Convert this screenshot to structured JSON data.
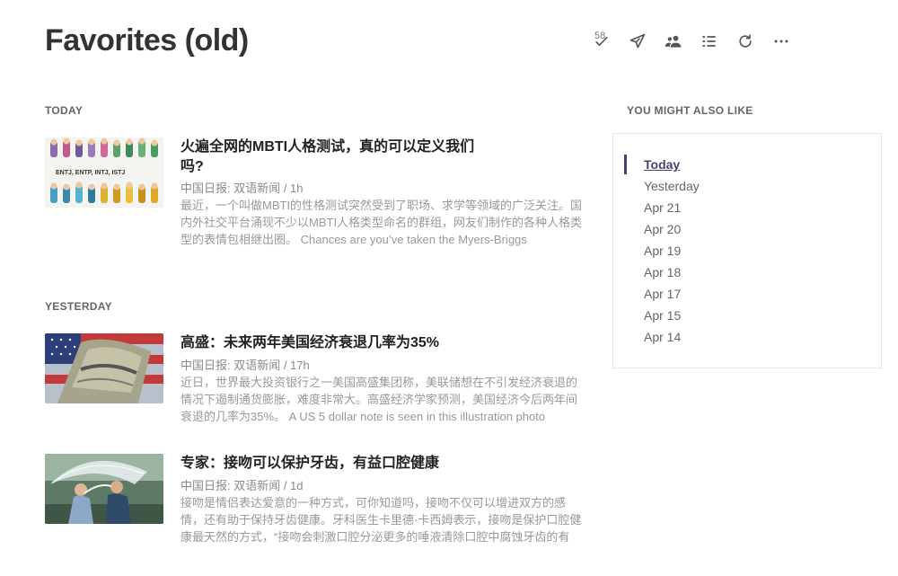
{
  "header": {
    "title": "Favorites (old)",
    "toolbar": {
      "unread_count": "58",
      "mark_read_icon": "check-icon",
      "share_icon": "send-icon",
      "people_icon": "people-icon",
      "list_icon": "list-icon",
      "refresh_icon": "refresh-icon",
      "more_icon": "more-icon"
    }
  },
  "sections": [
    {
      "label": "TODAY",
      "articles": [
        {
          "title": "火遍全网的MBTI人格测试，真的可以定义我们吗?",
          "source": "中国日报: 双语新闻 / 1h",
          "summary": "最近，一个叫做MBTI的性格测试突然受到了职场、求学等领域的广泛关注。国内外社交平台涌现不少以MBTI人格类型命名的群组，网友们制作的各种人格类型的表情包相继出圈。 Chances are you’ve taken the Myers-Briggs",
          "thumb_text": "ENTJ, ENTP, INTJ, ISTJ"
        }
      ]
    },
    {
      "label": "YESTERDAY",
      "articles": [
        {
          "title": "高盛：未来两年美国经济衰退几率为35%",
          "source": "中国日报: 双语新闻 / 17h",
          "summary": "近日，世界最大投资银行之一美国高盛集团称，美联储想在不引发经济衰退的情况下遏制通货膨胀，难度非常大。高盛经济学家预测，美国经济今后两年间衰退的几率为35%。 A US 5 dollar note is seen in this illustration photo"
        },
        {
          "title": "专家：接吻可以保护牙齿，有益口腔健康",
          "source": "中国日报: 双语新闻 / 1d",
          "summary": "接吻是情侣表达爱意的一种方式，可你知道吗，接吻不仅可以增进双方的感情，还有助于保持牙齿健康。牙科医生卡里德·卡西姆表示，接吻是保护口腔健康最天然的方式，“接吻会刺激口腔分泌更多的唾液清除口腔中腐蚀牙齿的有"
        }
      ]
    }
  ],
  "aside": {
    "label": "YOU MIGHT ALSO LIKE",
    "dates": [
      "Today",
      "Yesterday",
      "Apr 21",
      "Apr 20",
      "Apr 19",
      "Apr 18",
      "Apr 17",
      "Apr 15",
      "Apr 14"
    ],
    "active": "Today"
  },
  "colors": {
    "accent": "#4b3f72",
    "title": "#333333",
    "muted": "#999999"
  }
}
